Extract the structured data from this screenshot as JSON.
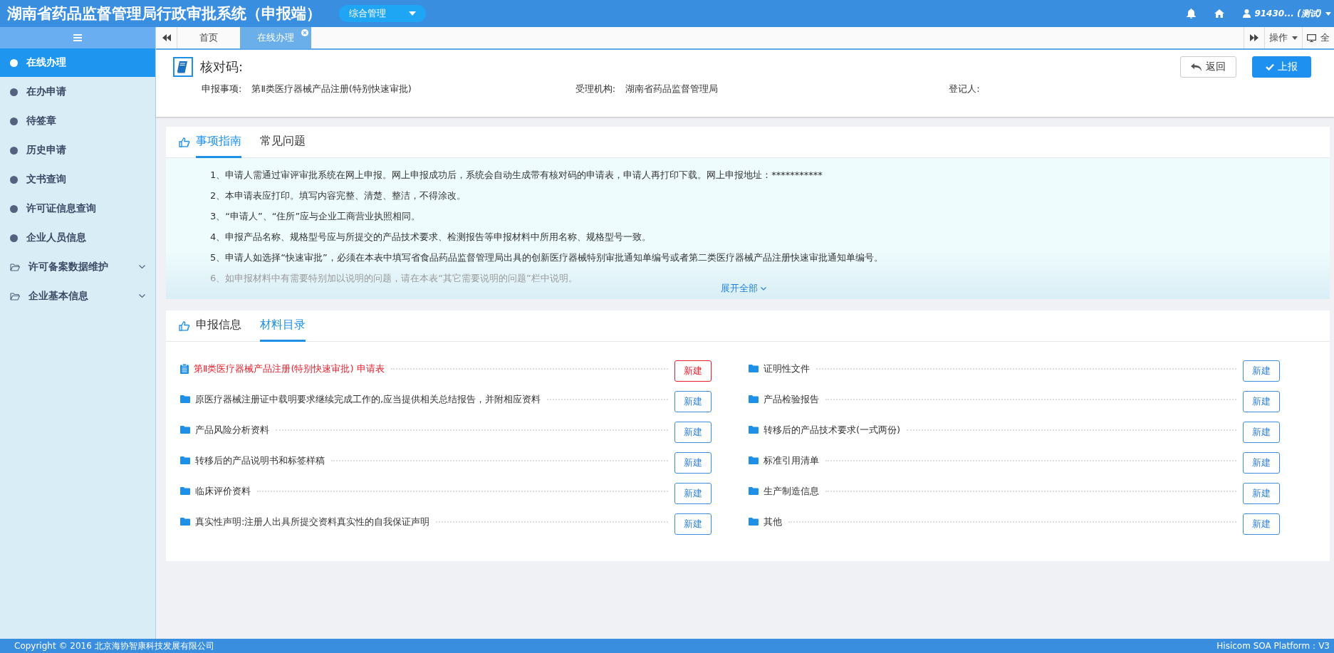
{
  "header": {
    "title": "湖南省药品监督管理局行政审批系统（申报端）",
    "module_select": "综合管理",
    "user": "91430... (测试)"
  },
  "sidebar": {
    "items": [
      {
        "label": "在线办理",
        "kind": "dot",
        "selected": true
      },
      {
        "label": "在办申请",
        "kind": "dot",
        "selected": false
      },
      {
        "label": "待签章",
        "kind": "dot",
        "selected": false
      },
      {
        "label": "历史申请",
        "kind": "dot",
        "selected": false
      },
      {
        "label": "文书查询",
        "kind": "dot",
        "selected": false
      },
      {
        "label": "许可证信息查询",
        "kind": "dot",
        "selected": false
      },
      {
        "label": "企业人员信息",
        "kind": "dot",
        "selected": false
      },
      {
        "label": "许可备案数据维护",
        "kind": "folder",
        "selected": false
      },
      {
        "label": "企业基本信息",
        "kind": "folder",
        "selected": false
      }
    ]
  },
  "tabbar": {
    "tabs": [
      {
        "label": "首页",
        "selected": false,
        "closable": false
      },
      {
        "label": "在线办理",
        "selected": true,
        "closable": true
      }
    ],
    "actions_menu": "操作",
    "fullscreen": "全"
  },
  "summary": {
    "title": "核对码:",
    "back_button": "返回",
    "submit_button": "上报",
    "fields": [
      {
        "label": "申报事项:",
        "value": "第Ⅱ类医疗器械产品注册(特别快速审批)"
      },
      {
        "label": "受理机构:",
        "value": "湖南省药品监督管理局"
      },
      {
        "label": "登记人:"
      }
    ]
  },
  "guide": {
    "tabs": [
      {
        "label": "事项指南",
        "selected": true
      },
      {
        "label": "常见问题",
        "selected": false
      }
    ],
    "lines": [
      "1、申请人需通过审评审批系统在网上申报。网上申报成功后，系统会自动生成带有核对码的申请表，申请人再打印下载。网上申报地址：***********",
      "2、本申请表应打印。填写内容完整、清楚、整洁，不得涂改。",
      "3、“申请人”、“住所”应与企业工商营业执照相同。",
      "4、申报产品名称、规格型号应与所提交的产品技术要求、检测报告等申报材料中所用名称、规格型号一致。",
      "5、申请人如选择“快速审批”，必须在本表中填写省食品药品监督管理局出具的创新医疗器械特别审批通知单编号或者第二类医疗器械产品注册快速审批通知单编号。",
      "6、如申报材料中有需要特别加以说明的问题，请在本表“其它需要说明的问题”栏中说明。"
    ],
    "expand_link": "展开全部"
  },
  "materials": {
    "tabs": [
      {
        "label": "申报信息",
        "selected": false
      },
      {
        "label": "材料目录",
        "selected": true
      }
    ],
    "items": [
      {
        "label": "第Ⅱ类医疗器械产品注册(特别快速审批) 申请表",
        "kind": "form",
        "button": "新建"
      },
      {
        "label": "证明性文件",
        "kind": "folder",
        "button": "新建"
      },
      {
        "label": "原医疗器械注册证中载明要求继续完成工作的,应当提供相关总结报告，并附相应资料",
        "kind": "folder",
        "button": "新建"
      },
      {
        "label": "产品检验报告",
        "kind": "folder",
        "button": "新建"
      },
      {
        "label": "产品风险分析资料",
        "kind": "folder",
        "button": "新建"
      },
      {
        "label": "转移后的产品技术要求(一式两份)",
        "kind": "folder",
        "button": "新建"
      },
      {
        "label": "转移后的产品说明书和标签样稿",
        "kind": "folder",
        "button": "新建"
      },
      {
        "label": "标准引用清单",
        "kind": "folder",
        "button": "新建"
      },
      {
        "label": "临床评价资料",
        "kind": "folder",
        "button": "新建"
      },
      {
        "label": "生产制造信息",
        "kind": "folder",
        "button": "新建"
      },
      {
        "label": "真实性声明:注册人出具所提交资料真实性的自我保证声明",
        "kind": "folder",
        "button": "新建"
      },
      {
        "label": "其他",
        "kind": "folder",
        "button": "新建"
      }
    ]
  },
  "footer": {
    "copyright": "Copyright © 2016 北京海协智康科技发展有限公司",
    "platform": "Hisicom SOA Platform：V3"
  }
}
